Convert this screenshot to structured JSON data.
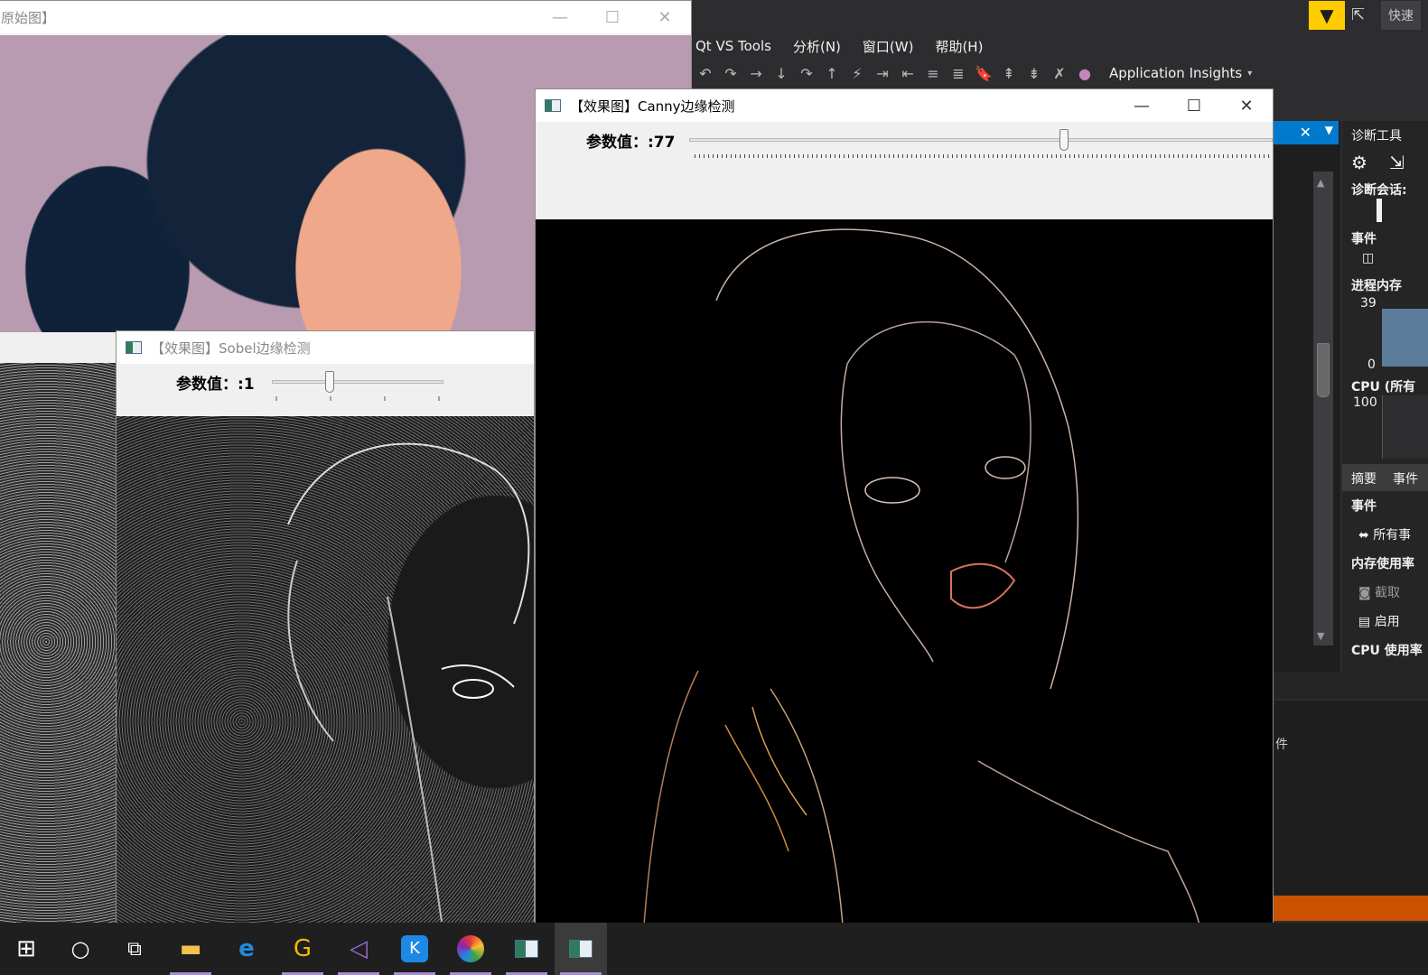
{
  "vs": {
    "menu": [
      "Qt VS Tools",
      "分析(N)",
      "窗口(W)",
      "帮助(H)"
    ],
    "toolbar_ai": "Application Insights",
    "quick_launch": "快速",
    "diag": {
      "title": "诊断工具",
      "session": "诊断会话:",
      "events": "事件",
      "process_memory": "进程内存",
      "mem_max": "39",
      "mem_min": "0",
      "cpu": "CPU (所有",
      "cpu_max": "100",
      "tab_summary": "摘要",
      "tab_events": "事件",
      "events_header": "事件",
      "all_events": "所有事",
      "memory_usage": "内存使用率",
      "snapshot": "截取",
      "enable": "启用",
      "cpu_usage": "CPU 使用率"
    },
    "bottom_text": "件"
  },
  "windows": {
    "original": {
      "title": "原始图】"
    },
    "sobel": {
      "title": "【效果图】Sobel边缘检测",
      "param_label": "参数值：:1"
    },
    "canny": {
      "title": "【效果图】Canny边缘检测",
      "param_label": "参数值：:77"
    }
  },
  "controls": {
    "minimize": "—",
    "maximize": "☐",
    "close": "✕"
  },
  "trackbars": {
    "sobel_value": 1,
    "canny_value": 77
  },
  "taskbar": {
    "items": [
      "start-icon",
      "cortana-icon",
      "task-view-icon",
      "file-explorer-icon",
      "edge-icon",
      "g-app-icon",
      "visual-studio-icon",
      "k-app-icon",
      "color-wheel-app-icon",
      "opencv-window-icon",
      "opencv-window-icon-active"
    ]
  },
  "colors": {
    "vs_bg": "#2d2d30",
    "filter_yellow": "#ffcc00",
    "vs_accent": "#007acc",
    "status_orange": "#ca5100",
    "taskbar_underline": "#a78bd9"
  }
}
